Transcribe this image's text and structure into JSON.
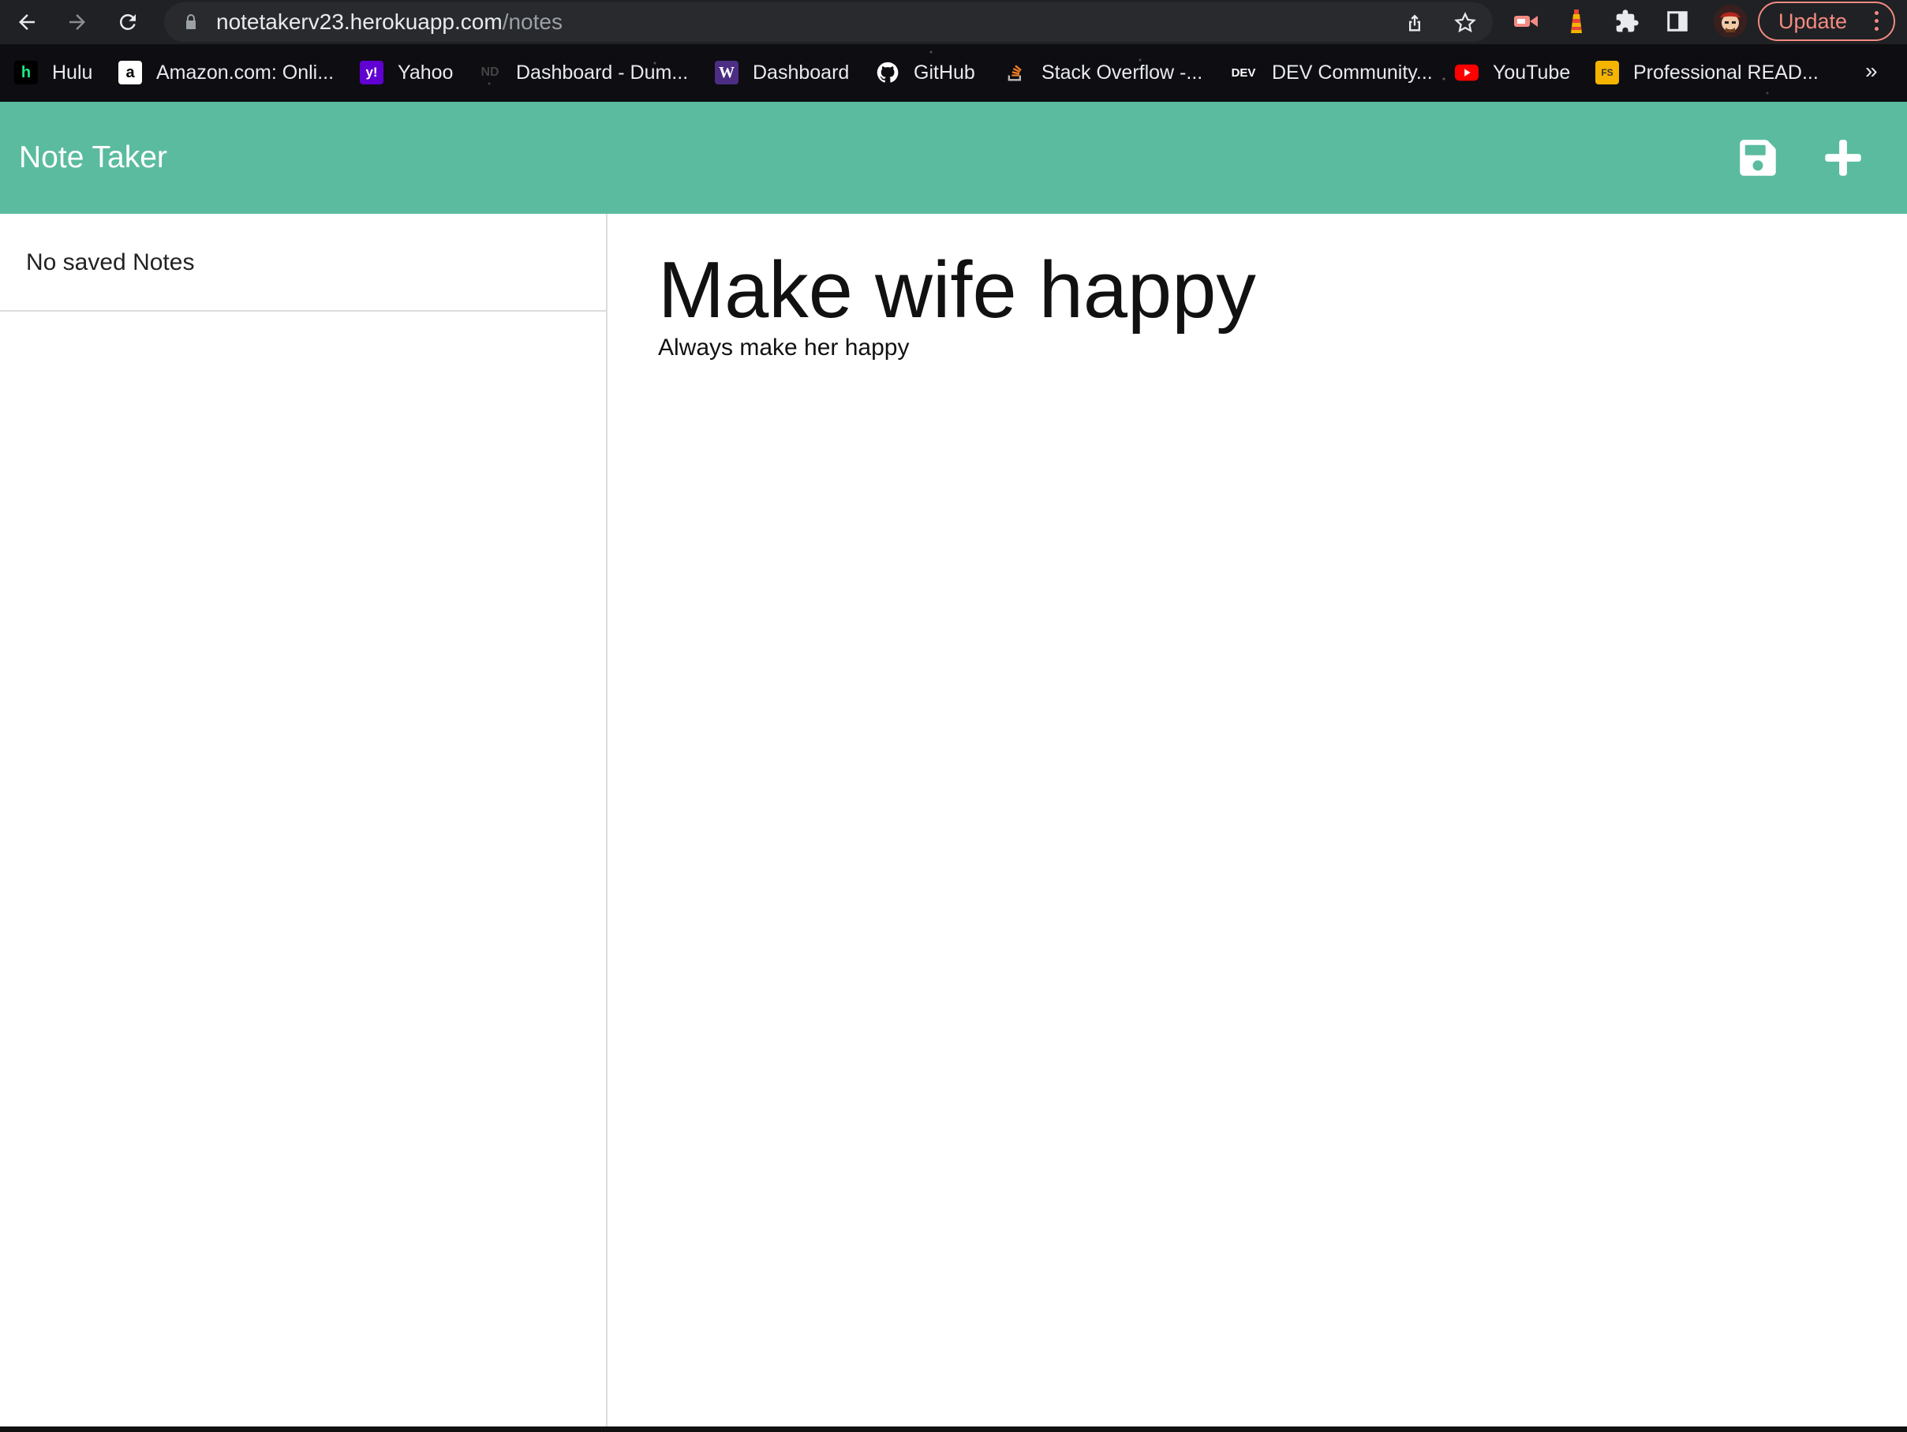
{
  "browser": {
    "url_host": "notetakerv23.herokuapp.com",
    "url_path": "/notes",
    "update_label": "Update",
    "nav": {
      "back": "back-arrow-icon",
      "forward": "forward-arrow-icon",
      "reload": "reload-icon"
    }
  },
  "bookmarks": {
    "items": [
      {
        "label": "Hulu",
        "icon": "h"
      },
      {
        "label": "Amazon.com: Onli...",
        "icon": "a"
      },
      {
        "label": "Yahoo",
        "icon": "y!"
      },
      {
        "label": "Dashboard - Dum...",
        "icon": "ND"
      },
      {
        "label": "Dashboard",
        "icon": "W"
      },
      {
        "label": "GitHub",
        "icon": ""
      },
      {
        "label": "Stack Overflow -...",
        "icon": ""
      },
      {
        "label": "DEV Community...",
        "icon": "DEV"
      },
      {
        "label": "YouTube",
        "icon": ""
      },
      {
        "label": "Professional READ...",
        "icon": "FS"
      }
    ],
    "more": "»"
  },
  "app": {
    "title": "Note Taker",
    "accent_color": "#5bbb9f",
    "sidebar": {
      "empty_text": "No saved Notes"
    },
    "note": {
      "title": "Make wife happy",
      "text": "Always make her happy"
    }
  }
}
